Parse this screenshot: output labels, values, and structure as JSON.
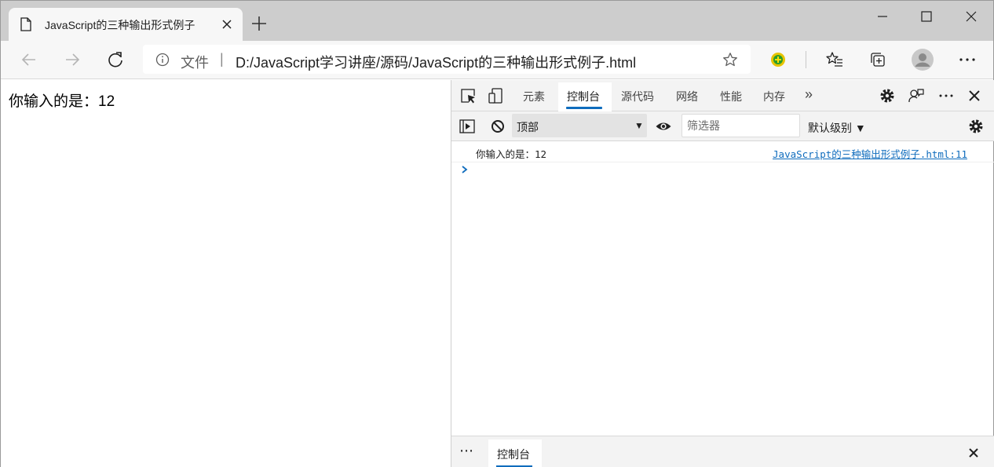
{
  "browser": {
    "tab": {
      "title": "JavaScript的三种输出形式例子"
    },
    "address": {
      "label": "文件",
      "separator": "|",
      "url": "D:/JavaScript学习讲座/源码/JavaScript的三种输出形式例子.html"
    },
    "icons": {
      "back": "back-arrow-icon",
      "forward": "forward-arrow-icon",
      "refresh": "refresh-icon",
      "info": "info-icon",
      "favorite": "star-icon",
      "extension": "extension-icon",
      "favorites": "favorites-icon",
      "collections": "collections-icon",
      "profile": "profile-icon",
      "menu": "more-icon"
    }
  },
  "page": {
    "output_text": "你输入的是：12"
  },
  "devtools": {
    "tabs": [
      {
        "label": "元素"
      },
      {
        "label": "控制台"
      },
      {
        "label": "源代码"
      },
      {
        "label": "网络"
      },
      {
        "label": "性能"
      },
      {
        "label": "内存"
      }
    ],
    "overflow": "»",
    "console": {
      "context": "顶部",
      "filter_placeholder": "筛选器",
      "levels": "默认级别 ▼",
      "logs": [
        {
          "text": "你输入的是：12",
          "source": "JavaScript的三种输出形式例子.html:11"
        }
      ],
      "prompt": "›"
    },
    "drawer": {
      "more": "⋯",
      "tab": "控制台"
    }
  },
  "colors": {
    "accent": "#0f6cbd",
    "tabstrip": "#cdcdcd",
    "toolbar": "#f7f7f7"
  }
}
